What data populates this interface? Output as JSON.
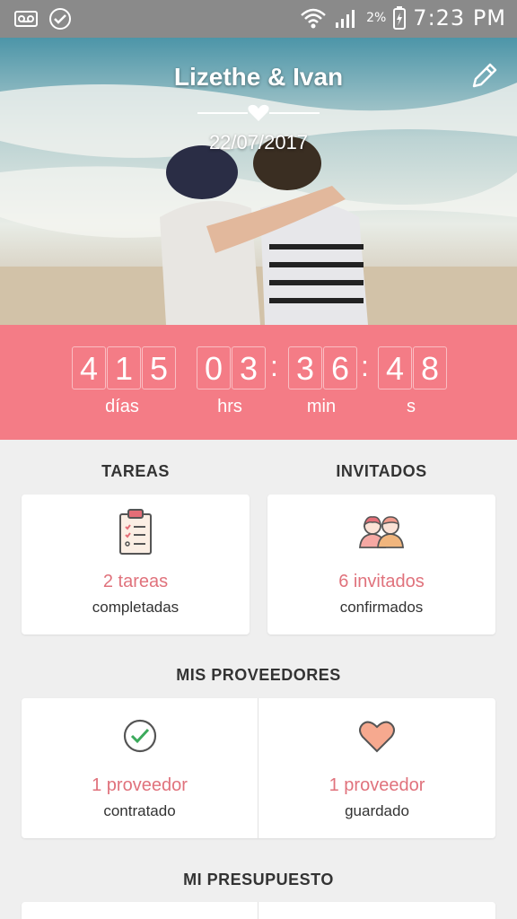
{
  "status_bar": {
    "battery_pct": "2%",
    "time": "7:23 PM"
  },
  "hero": {
    "couple": "Lizethe & Ivan",
    "date": "22/07/2017"
  },
  "countdown": {
    "days": [
      "4",
      "1",
      "5"
    ],
    "hours": [
      "0",
      "3"
    ],
    "minutes": [
      "3",
      "6"
    ],
    "seconds": [
      "4",
      "8"
    ],
    "labels": {
      "days": "días",
      "hours": "hrs",
      "minutes": "min",
      "seconds": "s"
    }
  },
  "tasks": {
    "title": "TAREAS",
    "value": "2 tareas",
    "sub": "completadas"
  },
  "guests": {
    "title": "INVITADOS",
    "value": "6 invitados",
    "sub": "confirmados"
  },
  "providers": {
    "title": "MIS PROVEEDORES",
    "hired": {
      "value": "1 proveedor",
      "sub": "contratado"
    },
    "saved": {
      "value": "1 proveedor",
      "sub": "guardado"
    }
  },
  "budget": {
    "title": "MI PRESUPUESTO"
  },
  "colors": {
    "accent": "#f47c86",
    "accent_text": "#e0727c",
    "status_bar": "#8a8a8a"
  }
}
